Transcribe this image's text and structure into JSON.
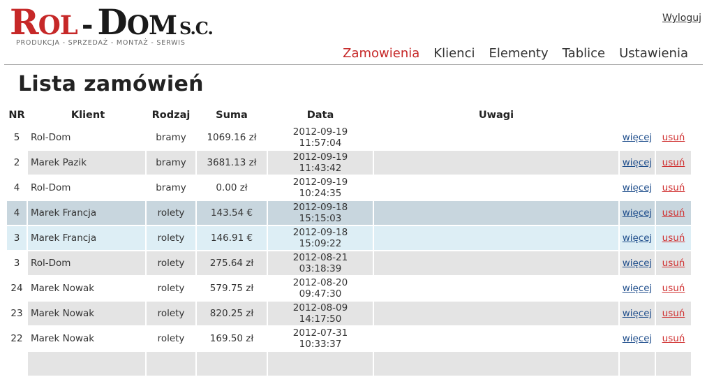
{
  "logo": {
    "rol_first": "R",
    "rol_rest": "OL",
    "dash": "-",
    "dom_first": "D",
    "dom_rest": "OM",
    "sc": "S.C.",
    "tagline": "PRODUKCJA - SPRZEDAŻ - MONTAŻ - SERWIS"
  },
  "header": {
    "logout": "Wyloguj"
  },
  "nav": {
    "items": [
      "Zamowienia",
      "Klienci",
      "Elementy",
      "Tablice",
      "Ustawienia"
    ],
    "active": "Zamowienia"
  },
  "page": {
    "title": "Lista zamówień"
  },
  "table": {
    "headers": {
      "nr": "NR",
      "client": "Klient",
      "type": "Rodzaj",
      "sum": "Suma",
      "date": "Data",
      "notes": "Uwagi"
    },
    "more_label": "więcej",
    "delete_label": "usuń",
    "rows": [
      {
        "nr": "5",
        "client": "Rol-Dom",
        "type": "bramy",
        "sum": "1069.16 zł",
        "date": "2012-09-19 11:57:04",
        "notes": "",
        "style": "odd"
      },
      {
        "nr": "2",
        "client": "Marek Pazik",
        "type": "bramy",
        "sum": "3681.13 zł",
        "date": "2012-09-19 11:43:42",
        "notes": "",
        "style": "even"
      },
      {
        "nr": "4",
        "client": "Rol-Dom",
        "type": "bramy",
        "sum": "0.00 zł",
        "date": "2012-09-19 10:24:35",
        "notes": "",
        "style": "odd"
      },
      {
        "nr": "4",
        "client": "Marek Francja",
        "type": "rolety",
        "sum": "143.54 €",
        "date": "2012-09-18 15:15:03",
        "notes": "",
        "style": "selected"
      },
      {
        "nr": "3",
        "client": "Marek Francja",
        "type": "rolety",
        "sum": "146.91 €",
        "date": "2012-09-18 15:09:22",
        "notes": "",
        "style": "hover"
      },
      {
        "nr": "3",
        "client": "Rol-Dom",
        "type": "rolety",
        "sum": "275.64 zł",
        "date": "2012-08-21 03:18:39",
        "notes": "",
        "style": "even"
      },
      {
        "nr": "24",
        "client": "Marek Nowak",
        "type": "rolety",
        "sum": "579.75 zł",
        "date": "2012-08-20 09:47:30",
        "notes": "",
        "style": "odd"
      },
      {
        "nr": "23",
        "client": "Marek Nowak",
        "type": "rolety",
        "sum": "820.25 zł",
        "date": "2012-08-09 14:17:50",
        "notes": "",
        "style": "even"
      },
      {
        "nr": "22",
        "client": "Marek Nowak",
        "type": "rolety",
        "sum": "169.50 zł",
        "date": "2012-07-31 10:33:37",
        "notes": "",
        "style": "odd"
      },
      {
        "nr": "",
        "client": "",
        "type": "",
        "sum": "",
        "date": "",
        "notes": "",
        "style": "even"
      }
    ]
  },
  "colors": {
    "brand_red": "#c62828",
    "link_blue": "#1f4e8c",
    "row_gray": "#e4e4e4",
    "row_selected": "#c8d6de",
    "row_hover": "#ddeef5"
  }
}
